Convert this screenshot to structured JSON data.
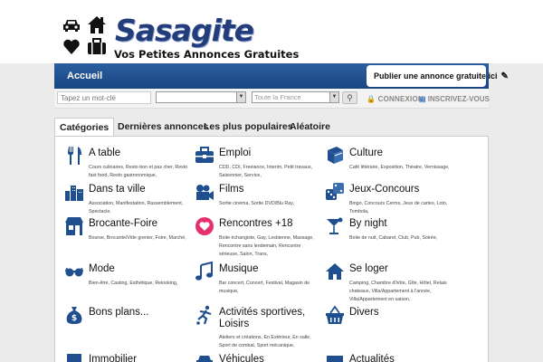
{
  "brand": {
    "name": "Sasagite",
    "tagline": "Vos Petites Annonces Gratuites"
  },
  "nav": {
    "home": "Accueil",
    "publish": "Publier une annonce gratuite ici"
  },
  "search": {
    "keyword_placeholder": "Tapez un mot-clé",
    "location_value": "Toute la France",
    "login": "CONNEXION",
    "signup": "INSCRIVEZ-VOUS"
  },
  "tabs": [
    "Catégories",
    "Dernières annonces",
    "Les plus populaires",
    "Aléatoire"
  ],
  "categories": [
    {
      "title": "A table",
      "icon": "utensils-icon",
      "sub": "Cours culinaires, Resto bon et pas cher, Resto fast food, Resto gastronomique,"
    },
    {
      "title": "Emploi",
      "icon": "briefcase-icon",
      "sub": "CDD, CDI, Freelance, Interim, Petit travaux, Saisonnier, Service,"
    },
    {
      "title": "Culture",
      "icon": "book-icon",
      "sub": "Café littéraire, Exposition, Théatre, Vernissage,"
    },
    {
      "title": "Dans ta ville",
      "icon": "city-icon",
      "sub": "Association, Manifestation, Rassemblement, Spectacle,"
    },
    {
      "title": "Films",
      "icon": "film-icon",
      "sub": "Sortie cinéma, Sortie DVD/Blu Ray,"
    },
    {
      "title": "Jeux-Concours",
      "icon": "dice-icon",
      "sub": "Bingo, Concours Cerms, Jeux de cartes, Loto, Tombola,"
    },
    {
      "title": "Brocante-Foire",
      "icon": "shop-icon",
      "sub": "Bourse, Brocante/Vide grenier, Foire, Marché,"
    },
    {
      "title": "Rencontres +18",
      "icon": "heart-icon",
      "sub": "Boite échangiste, Gay, Lesbienne, Massage, Rencontre sans lendemain, Rencontre sérieuse, Salon, Trans,"
    },
    {
      "title": "By night",
      "icon": "cocktail-icon",
      "sub": "Boite de nuit, Cabaret, Club, Pub, Soirée,"
    },
    {
      "title": "Mode",
      "icon": "glasses-icon",
      "sub": "Bien-être, Casting, Esthétique, Relooking,"
    },
    {
      "title": "Musique",
      "icon": "music-icon",
      "sub": "Bar concert, Concert, Festival, Magasin de musique,"
    },
    {
      "title": "Se loger",
      "icon": "house-icon",
      "sub": "Camping, Chambre d'hôte, Gîte, Hôtel, Relais chateaux, Villa/Appartement à l'année, Villa/Appartement en saison,"
    },
    {
      "title": "Bons plans...",
      "icon": "money-bag-icon",
      "sub": ""
    },
    {
      "title": "Activités sportives, Loisirs",
      "icon": "sport-icon",
      "sub": "Ateliers et créations, En Extérieur, En salle, Sport de combat, Sport mécanique,"
    },
    {
      "title": "Divers",
      "icon": "basket-icon",
      "sub": ""
    },
    {
      "title": "Immobilier",
      "icon": "building-icon",
      "sub": ""
    },
    {
      "title": "Véhicules",
      "icon": "car-icon",
      "sub": ""
    },
    {
      "title": "Actualités",
      "icon": "newspaper-icon",
      "sub": ""
    }
  ],
  "colors": {
    "brand": "#233d7b",
    "navbar": "#1f4f8f",
    "icon": "#1f4f8f",
    "heart_badge": "#e5326e"
  }
}
